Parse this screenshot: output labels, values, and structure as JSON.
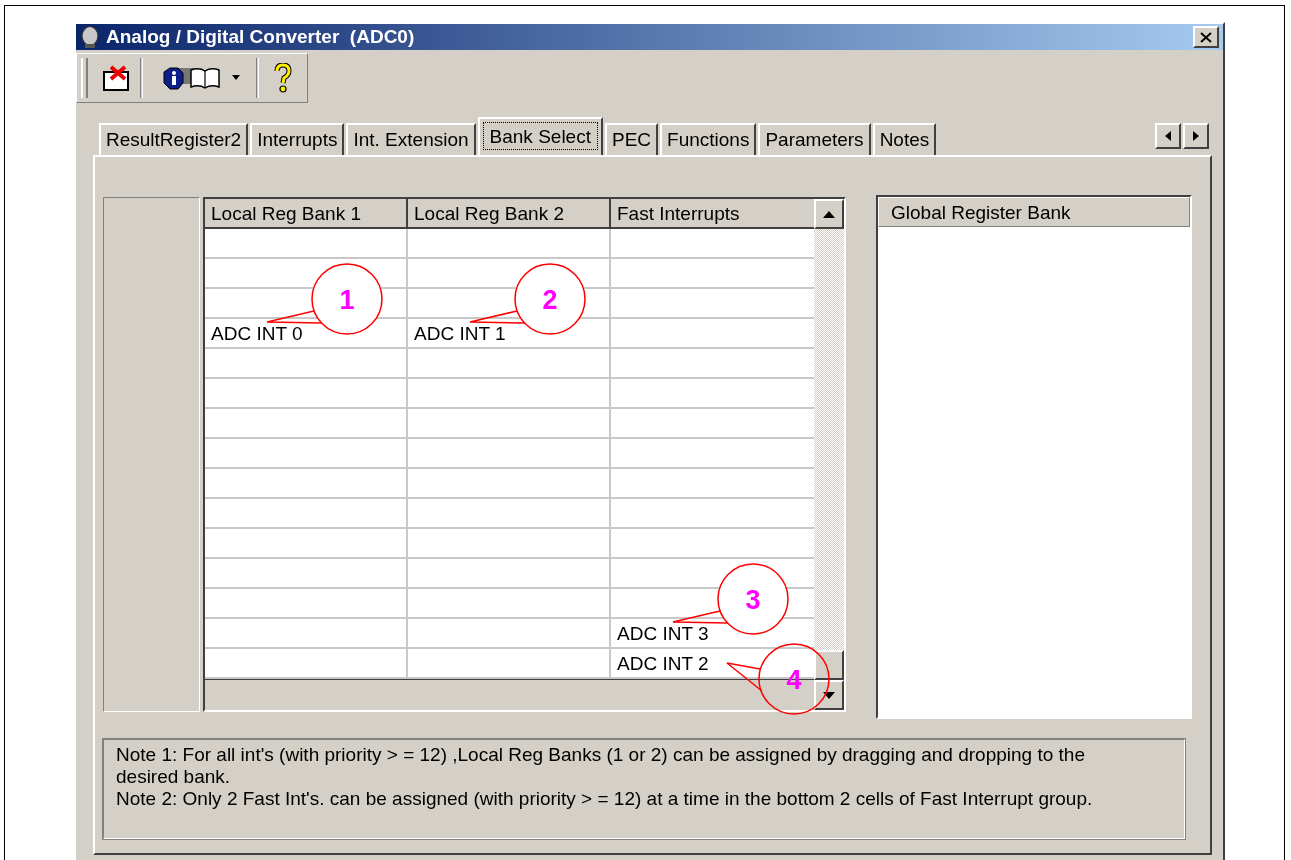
{
  "window": {
    "title": "Analog / Digital Converter  (ADC0)"
  },
  "tabs": [
    {
      "label": "ResultRegister2",
      "selected": false
    },
    {
      "label": "Interrupts",
      "selected": false
    },
    {
      "label": "Int. Extension",
      "selected": false
    },
    {
      "label": "Bank Select",
      "selected": true
    },
    {
      "label": "PEC",
      "selected": false
    },
    {
      "label": "Functions",
      "selected": false
    },
    {
      "label": "Parameters",
      "selected": false
    },
    {
      "label": "Notes",
      "selected": false
    }
  ],
  "grid": {
    "columns": [
      "Local Reg Bank 1",
      "Local Reg Bank 2",
      "Fast Interrupts"
    ],
    "rows": [
      {
        "cells": []
      },
      {
        "cells": []
      },
      {
        "cells": []
      },
      {
        "cells": [
          {
            "text": "ADC INT 0",
            "callout": {
              "label": "1",
              "kind": "above"
            }
          },
          {
            "text": "ADC INT 1",
            "callout": {
              "label": "2",
              "kind": "above"
            }
          }
        ]
      },
      {
        "cells": []
      },
      {
        "cells": []
      },
      {
        "cells": []
      },
      {
        "cells": []
      },
      {
        "cells": []
      },
      {
        "cells": []
      },
      {
        "cells": []
      },
      {
        "cells": []
      },
      {
        "cells": []
      },
      {
        "cells": [
          null,
          null,
          {
            "text": "ADC INT 3",
            "callout": {
              "label": "3",
              "kind": "above"
            }
          }
        ]
      },
      {
        "cells": [
          null,
          null,
          {
            "text": "ADC INT 2",
            "callout": {
              "label": "4",
              "kind": "below-right"
            }
          }
        ]
      }
    ]
  },
  "global_register_bank": {
    "header": "Global Register Bank"
  },
  "notes": [
    "Note 1: For all int's (with priority > = 12) ,Local Reg Banks (1 or 2) can be assigned by dragging and dropping to the desired bank.",
    "Note 2: Only 2 Fast Int's. can be assigned (with priority > = 12) at a time in the bottom 2 cells of Fast Interrupt group."
  ]
}
